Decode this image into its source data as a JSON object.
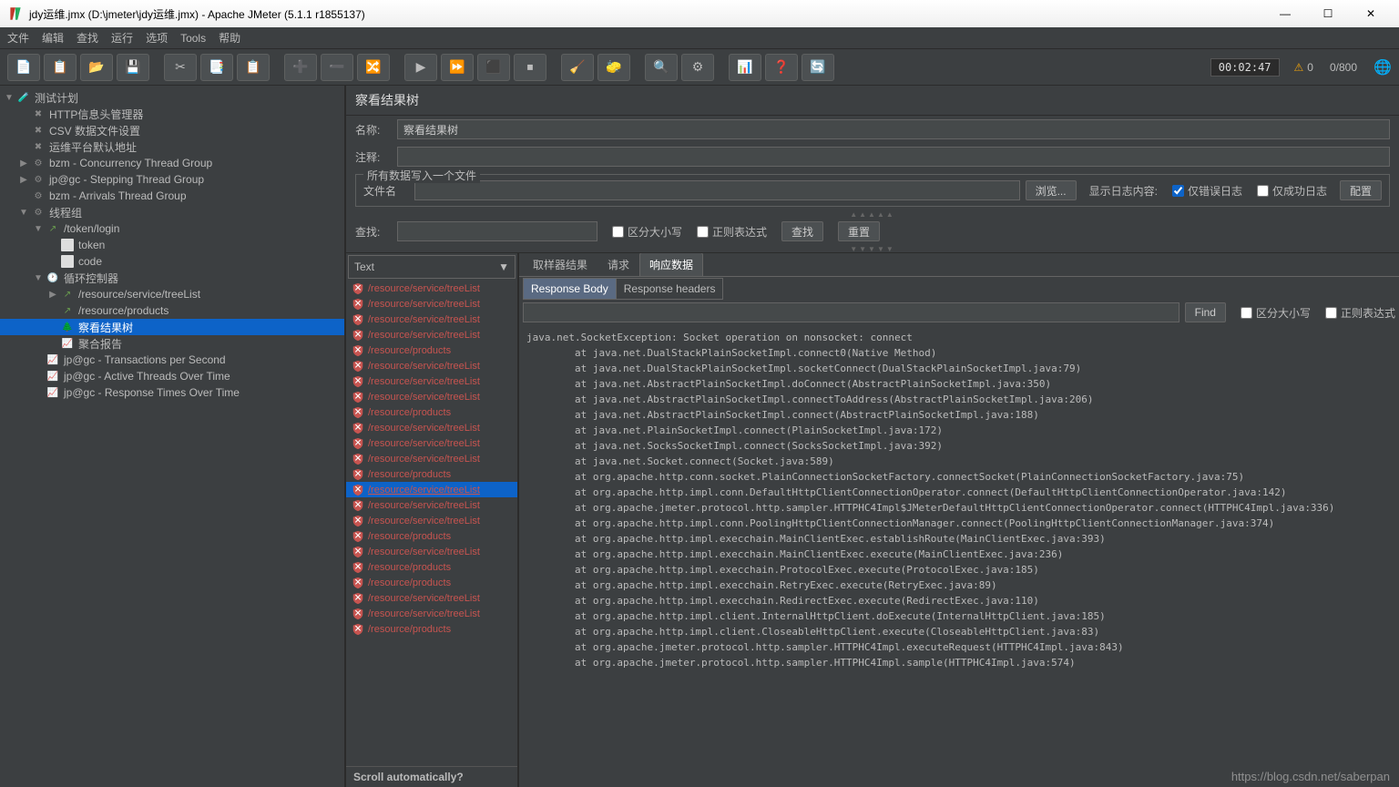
{
  "window": {
    "title": "jdy运维.jmx (D:\\jmeter\\jdy运维.jmx) - Apache JMeter (5.1.1 r1855137)",
    "minimize": "—",
    "maximize": "☐",
    "close": "✕"
  },
  "menu": [
    "文件",
    "编辑",
    "查找",
    "运行",
    "选项",
    "Tools",
    "帮助"
  ],
  "toolbar": {
    "icons": [
      "new",
      "templates",
      "open",
      "save",
      "",
      "cut",
      "copy",
      "paste",
      "",
      "add",
      "remove",
      "toggle",
      "",
      "start",
      "start-no-timers",
      "stop",
      "shutdown",
      "",
      "clear",
      "clear-all",
      "",
      "search",
      "function",
      "",
      "properties",
      "help",
      "heap"
    ],
    "timer": "00:02:47",
    "warn_count": "0",
    "threads": "0/800"
  },
  "tree": [
    {
      "d": 0,
      "tw": "▼",
      "ic": "beaker",
      "lbl": "测试计划"
    },
    {
      "d": 1,
      "tw": "",
      "ic": "wrench",
      "lbl": "HTTP信息头管理器"
    },
    {
      "d": 1,
      "tw": "",
      "ic": "wrench",
      "lbl": "CSV 数据文件设置"
    },
    {
      "d": 1,
      "tw": "",
      "ic": "wrench",
      "lbl": "运维平台默认地址"
    },
    {
      "d": 1,
      "tw": "▶",
      "ic": "gear",
      "lbl": "bzm - Concurrency Thread Group"
    },
    {
      "d": 1,
      "tw": "▶",
      "ic": "gear",
      "lbl": "jp@gc - Stepping Thread Group"
    },
    {
      "d": 1,
      "tw": "",
      "ic": "gear",
      "lbl": "bzm - Arrivals Thread Group"
    },
    {
      "d": 1,
      "tw": "▼",
      "ic": "gear",
      "lbl": "线程组"
    },
    {
      "d": 2,
      "tw": "▼",
      "ic": "arrow",
      "lbl": "/token/login"
    },
    {
      "d": 3,
      "tw": "",
      "ic": "doc",
      "lbl": "token"
    },
    {
      "d": 3,
      "tw": "",
      "ic": "doc",
      "lbl": "code"
    },
    {
      "d": 2,
      "tw": "▼",
      "ic": "clock",
      "lbl": "循环控制器"
    },
    {
      "d": 3,
      "tw": "▶",
      "ic": "arrow",
      "lbl": "/resource/service/treeList"
    },
    {
      "d": 3,
      "tw": "",
      "ic": "arrow",
      "lbl": "/resource/products"
    },
    {
      "d": 3,
      "tw": "",
      "ic": "tree",
      "lbl": "察看结果树",
      "sel": true
    },
    {
      "d": 3,
      "tw": "",
      "ic": "report",
      "lbl": "聚合报告"
    },
    {
      "d": 2,
      "tw": "",
      "ic": "report",
      "lbl": "jp@gc - Transactions per Second"
    },
    {
      "d": 2,
      "tw": "",
      "ic": "report",
      "lbl": "jp@gc - Active Threads Over Time"
    },
    {
      "d": 2,
      "tw": "",
      "ic": "report",
      "lbl": "jp@gc - Response Times Over Time"
    }
  ],
  "panel": {
    "title": "察看结果树",
    "name_label": "名称:",
    "name_value": "察看结果树",
    "comment_label": "注释:",
    "file_group": "所有数据写入一个文件",
    "file_label": "文件名",
    "browse": "浏览...",
    "log_display": "显示日志内容:",
    "errors_only": "仅错误日志",
    "success_only": "仅成功日志",
    "configure": "配置",
    "search_label": "查找:",
    "case_sensitive": "区分大小写",
    "regex": "正则表达式",
    "search_btn": "查找",
    "reset_btn": "重置"
  },
  "results": {
    "dropdown": "Text",
    "items": [
      "/resource/service/treeList",
      "/resource/service/treeList",
      "/resource/service/treeList",
      "/resource/service/treeList",
      "/resource/products",
      "/resource/service/treeList",
      "/resource/service/treeList",
      "/resource/service/treeList",
      "/resource/products",
      "/resource/service/treeList",
      "/resource/service/treeList",
      "/resource/service/treeList",
      "/resource/products",
      "/resource/service/treeList",
      "/resource/service/treeList",
      "/resource/service/treeList",
      "/resource/products",
      "/resource/service/treeList",
      "/resource/products",
      "/resource/products",
      "/resource/service/treeList",
      "/resource/service/treeList",
      "/resource/products"
    ],
    "selected_index": 13,
    "scroll_auto": "Scroll automatically?"
  },
  "detail": {
    "tabs": [
      "取样器结果",
      "请求",
      "响应数据"
    ],
    "active_tab": 2,
    "subtabs": [
      "Response Body",
      "Response headers"
    ],
    "active_subtab": 0,
    "find_btn": "Find",
    "find_case": "区分大小写",
    "find_regex": "正则表达式",
    "response": "java.net.SocketException: Socket operation on nonsocket: connect\n\tat java.net.DualStackPlainSocketImpl.connect0(Native Method)\n\tat java.net.DualStackPlainSocketImpl.socketConnect(DualStackPlainSocketImpl.java:79)\n\tat java.net.AbstractPlainSocketImpl.doConnect(AbstractPlainSocketImpl.java:350)\n\tat java.net.AbstractPlainSocketImpl.connectToAddress(AbstractPlainSocketImpl.java:206)\n\tat java.net.AbstractPlainSocketImpl.connect(AbstractPlainSocketImpl.java:188)\n\tat java.net.PlainSocketImpl.connect(PlainSocketImpl.java:172)\n\tat java.net.SocksSocketImpl.connect(SocksSocketImpl.java:392)\n\tat java.net.Socket.connect(Socket.java:589)\n\tat org.apache.http.conn.socket.PlainConnectionSocketFactory.connectSocket(PlainConnectionSocketFactory.java:75)\n\tat org.apache.http.impl.conn.DefaultHttpClientConnectionOperator.connect(DefaultHttpClientConnectionOperator.java:142)\n\tat org.apache.jmeter.protocol.http.sampler.HTTPHC4Impl$JMeterDefaultHttpClientConnectionOperator.connect(HTTPHC4Impl.java:336)\n\tat org.apache.http.impl.conn.PoolingHttpClientConnectionManager.connect(PoolingHttpClientConnectionManager.java:374)\n\tat org.apache.http.impl.execchain.MainClientExec.establishRoute(MainClientExec.java:393)\n\tat org.apache.http.impl.execchain.MainClientExec.execute(MainClientExec.java:236)\n\tat org.apache.http.impl.execchain.ProtocolExec.execute(ProtocolExec.java:185)\n\tat org.apache.http.impl.execchain.RetryExec.execute(RetryExec.java:89)\n\tat org.apache.http.impl.execchain.RedirectExec.execute(RedirectExec.java:110)\n\tat org.apache.http.impl.client.InternalHttpClient.doExecute(InternalHttpClient.java:185)\n\tat org.apache.http.impl.client.CloseableHttpClient.execute(CloseableHttpClient.java:83)\n\tat org.apache.jmeter.protocol.http.sampler.HTTPHC4Impl.executeRequest(HTTPHC4Impl.java:843)\n\tat org.apache.jmeter.protocol.http.sampler.HTTPHC4Impl.sample(HTTPHC4Impl.java:574)"
  },
  "watermark": "https://blog.csdn.net/saberpan"
}
